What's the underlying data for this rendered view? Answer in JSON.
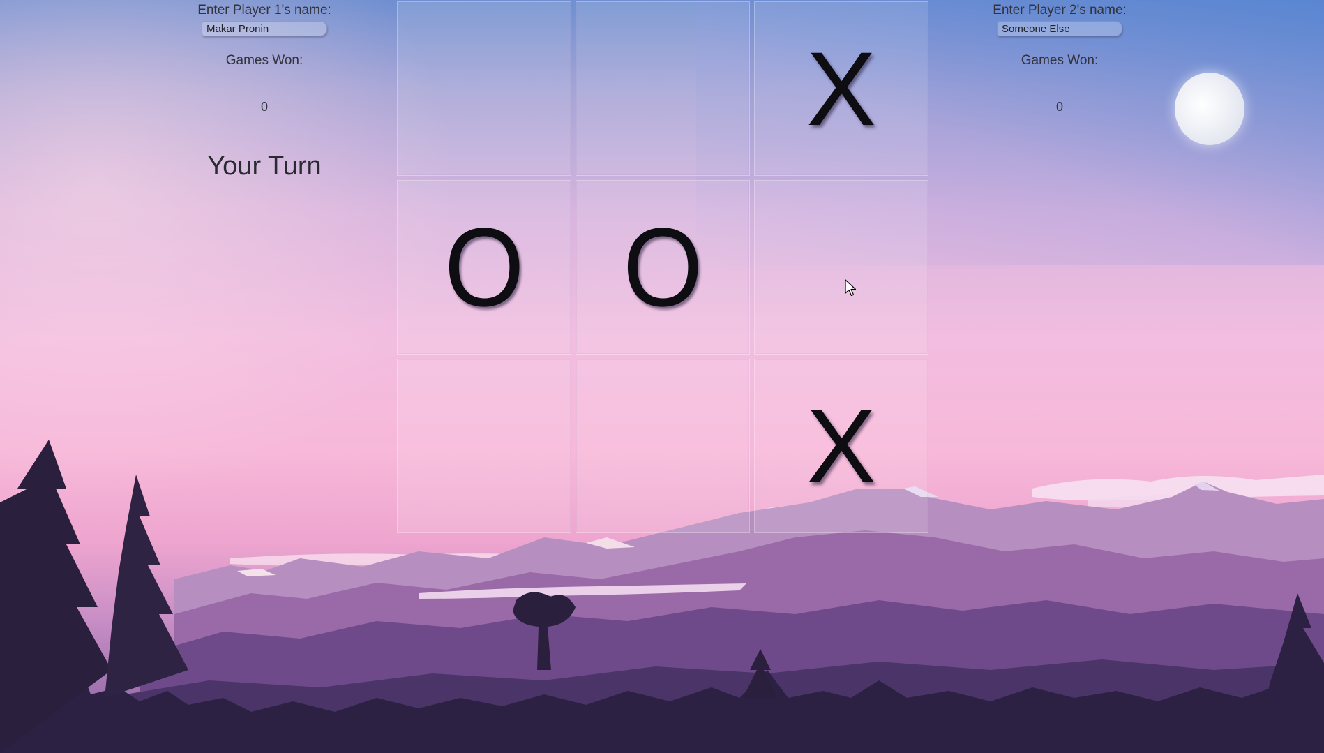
{
  "player1": {
    "prompt": "Enter Player 1's name:",
    "name": "Makar Pronin",
    "games_won_label": "Games Won:",
    "games_won": "0"
  },
  "player2": {
    "prompt": "Enter Player 2's name:",
    "name": "Someone Else",
    "games_won_label": "Games Won:",
    "games_won": "0"
  },
  "turn_text": "Your Turn",
  "board": {
    "cells": [
      "",
      "",
      "X",
      "O",
      "O",
      "",
      "",
      "",
      "X"
    ]
  },
  "colors": {
    "mark": "#0d0d12",
    "text": "#33333d"
  }
}
